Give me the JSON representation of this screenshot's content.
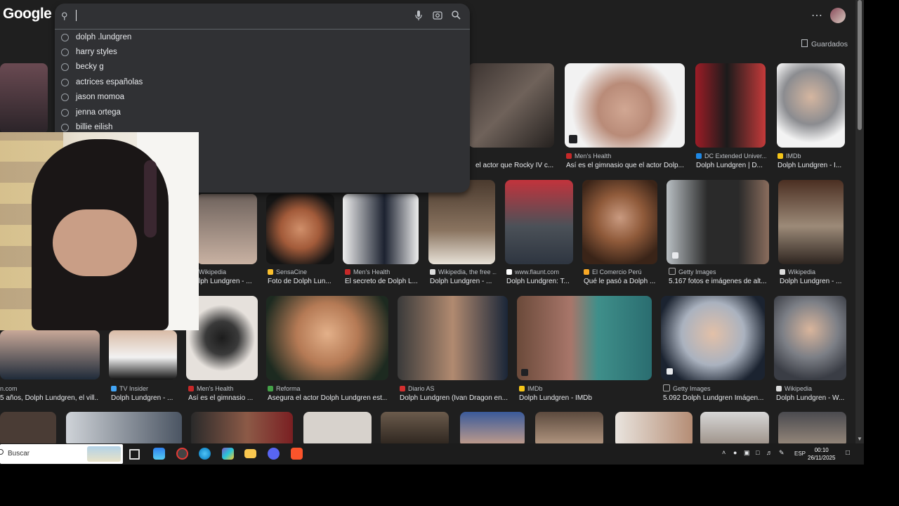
{
  "google": {
    "logo": "Google",
    "search_value": "",
    "suggestions": [
      {
        "text": "dolph .lundgren"
      },
      {
        "text": "harry styles"
      },
      {
        "text": "becky g"
      },
      {
        "text": "actrices españolas"
      },
      {
        "text": "jason momoa"
      },
      {
        "text": "jenna ortega"
      },
      {
        "text": "billie eilish"
      }
    ],
    "saved_label": "Guardados"
  },
  "results": {
    "row1": [
      {
        "source": "",
        "title": "el actor que Rocky IV c..."
      },
      {
        "source": "Men's Health",
        "title": "Así es el gimnasio que el actor Dolp..."
      },
      {
        "source": "DC Extended Univer...",
        "title": "Dolph Lundgren | D..."
      },
      {
        "source": "IMDb",
        "title": "Dolph Lundgren - I..."
      }
    ],
    "row2": [
      {
        "source": "Wikipedia",
        "title": "lph Lundgren - ..."
      },
      {
        "source": "SensaCine",
        "title": "Foto de Dolph Lun..."
      },
      {
        "source": "Men's Health",
        "title": "El secreto de Dolph L..."
      },
      {
        "source": "Wikipedia, the free ...",
        "title": "Dolph Lundgren - ..."
      },
      {
        "source": "www.flaunt.com",
        "title": "Dolph Lundgren: T..."
      },
      {
        "source": "El Comercio Perú",
        "title": "Qué le pasó a Dolph ..."
      },
      {
        "source": "Getty Images",
        "title": "5.167 fotos e imágenes de alt..."
      },
      {
        "source": "Wikipedia",
        "title": "Dolph Lundgren - ..."
      }
    ],
    "row3": [
      {
        "source": "n.com",
        "title": "5 años, Dolph Lundgren, el vill..."
      },
      {
        "source": "TV Insider",
        "title": "Dolph Lundgren - ..."
      },
      {
        "source": "Men's Health",
        "title": "Así es el gimnasio ..."
      },
      {
        "source": "Reforma",
        "title": "Asegura el actor Dolph Lundgren est..."
      },
      {
        "source": "Diario AS",
        "title": "Dolph Lundgren (Ivan Dragon en..."
      },
      {
        "source": "IMDb",
        "title": "Dolph Lundgren - IMDb"
      },
      {
        "source": "Getty Images",
        "title": "5.092 Dolph Lundgren Imágen..."
      },
      {
        "source": "Wikipedia",
        "title": "Dolph Lundgren - W..."
      }
    ]
  },
  "taskbar": {
    "search_label": "Buscar",
    "lang": "ESP",
    "time": "00:10",
    "date": "26/11/2025"
  }
}
